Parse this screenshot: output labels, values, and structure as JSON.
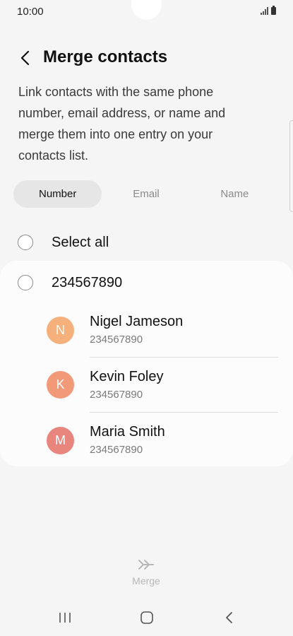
{
  "status_bar": {
    "time": "10:00"
  },
  "header": {
    "title": "Merge contacts"
  },
  "description": "Link contacts with the same phone number, email address, or name and merge them into one entry on your contacts list.",
  "tabs": [
    {
      "label": "Number",
      "active": true
    },
    {
      "label": "Email",
      "active": false
    },
    {
      "label": "Name",
      "active": false
    }
  ],
  "select_all": {
    "label": "Select all"
  },
  "group": {
    "number": "234567890",
    "contacts": [
      {
        "initial": "N",
        "name": "Nigel Jameson",
        "number": "234567890",
        "avatar_color": "#f6b07c"
      },
      {
        "initial": "K",
        "name": "Kevin Foley",
        "number": "234567890",
        "avatar_color": "#f29a78"
      },
      {
        "initial": "M",
        "name": "Maria Smith",
        "number": "234567890",
        "avatar_color": "#e8857c"
      }
    ]
  },
  "footer": {
    "merge_label": "Merge"
  },
  "icons": {
    "back": "chevron-left-icon",
    "merge": "merge-arrows-icon",
    "nav_recents": "recents-icon",
    "nav_home": "home-icon",
    "nav_back": "back-icon"
  }
}
